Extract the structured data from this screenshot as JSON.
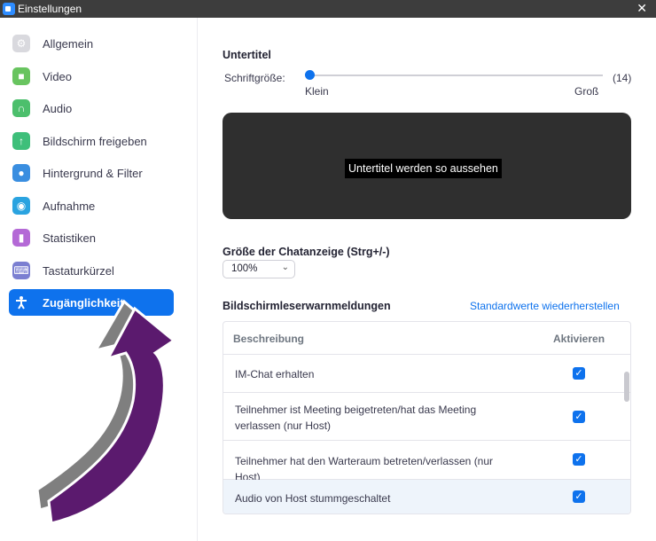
{
  "window": {
    "title": "Einstellungen",
    "close_glyph": "✕"
  },
  "sidebar": {
    "items": [
      {
        "label": "Allgemein",
        "icon": "gear-icon",
        "color": "#d9d9de"
      },
      {
        "label": "Video",
        "icon": "video-icon",
        "color": "#68c45f"
      },
      {
        "label": "Audio",
        "icon": "headphones-icon",
        "color": "#4cbf6c"
      },
      {
        "label": "Bildschirm freigeben",
        "icon": "share-screen-icon",
        "color": "#3ebf7a"
      },
      {
        "label": "Hintergrund & Filter",
        "icon": "portrait-icon",
        "color": "#3a8ee0"
      },
      {
        "label": "Aufnahme",
        "icon": "record-icon",
        "color": "#2aa3e0"
      },
      {
        "label": "Statistiken",
        "icon": "stats-icon",
        "color": "#b469d6"
      },
      {
        "label": "Tastaturkürzel",
        "icon": "keyboard-icon",
        "color": "#7b7fd1"
      },
      {
        "label": "Zugänglichkeit",
        "icon": "accessibility-icon",
        "color": "#0e72ed",
        "active": true
      }
    ]
  },
  "captions": {
    "title": "Untertitel",
    "font_size_label": "Schriftgröße:",
    "font_size_value": "(14)",
    "min_label": "Klein",
    "max_label": "Groß",
    "slider_level": 0.0,
    "preview_text": "Untertitel werden so aussehen"
  },
  "chat": {
    "title": "Größe der Chatanzeige (Strg+/-)",
    "selected": "100%"
  },
  "alerts": {
    "title": "Bildschirmleserwarnmeldungen",
    "restore_link": "Standardwerte wiederherstellen",
    "col_description": "Beschreibung",
    "col_enable": "Aktivieren",
    "rows": [
      {
        "text": "IM-Chat erhalten",
        "checked": true
      },
      {
        "text": "Teilnehmer ist Meeting beigetreten/hat das Meeting verlassen (nur Host)",
        "checked": true
      },
      {
        "text": "Teilnehmer hat den Warteraum betreten/verlassen (nur Host)",
        "checked": true
      },
      {
        "text": "Audio von Host stummgeschaltet",
        "checked": true
      }
    ]
  },
  "colors": {
    "accent": "#0e72ed",
    "annotation_arrow": "#5b1a6e",
    "annotation_shadow": "#7f7f7f"
  }
}
